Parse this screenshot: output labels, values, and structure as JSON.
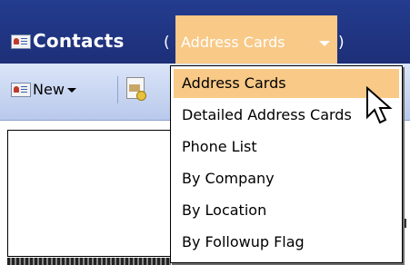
{
  "window": {
    "title": "Contacts",
    "paren_open": "(",
    "paren_close": ")"
  },
  "view_selector": {
    "current": "Address Cards"
  },
  "toolbar": {
    "new_label": "New"
  },
  "view_menu": {
    "items": [
      {
        "label": "Address Cards",
        "selected": true
      },
      {
        "label": "Detailed Address Cards",
        "selected": false
      },
      {
        "label": "Phone List",
        "selected": false
      },
      {
        "label": "By Company",
        "selected": false
      },
      {
        "label": "By Location",
        "selected": false
      },
      {
        "label": "By Followup Flag",
        "selected": false
      }
    ]
  },
  "colors": {
    "title_bar": "#1d2f78",
    "highlight": "#f8c987",
    "toolbar": "#c7d5f0"
  },
  "icons": {
    "contacts": "contacts-card-icon",
    "print": "print-icon",
    "cursor": "mouse-pointer-icon"
  }
}
